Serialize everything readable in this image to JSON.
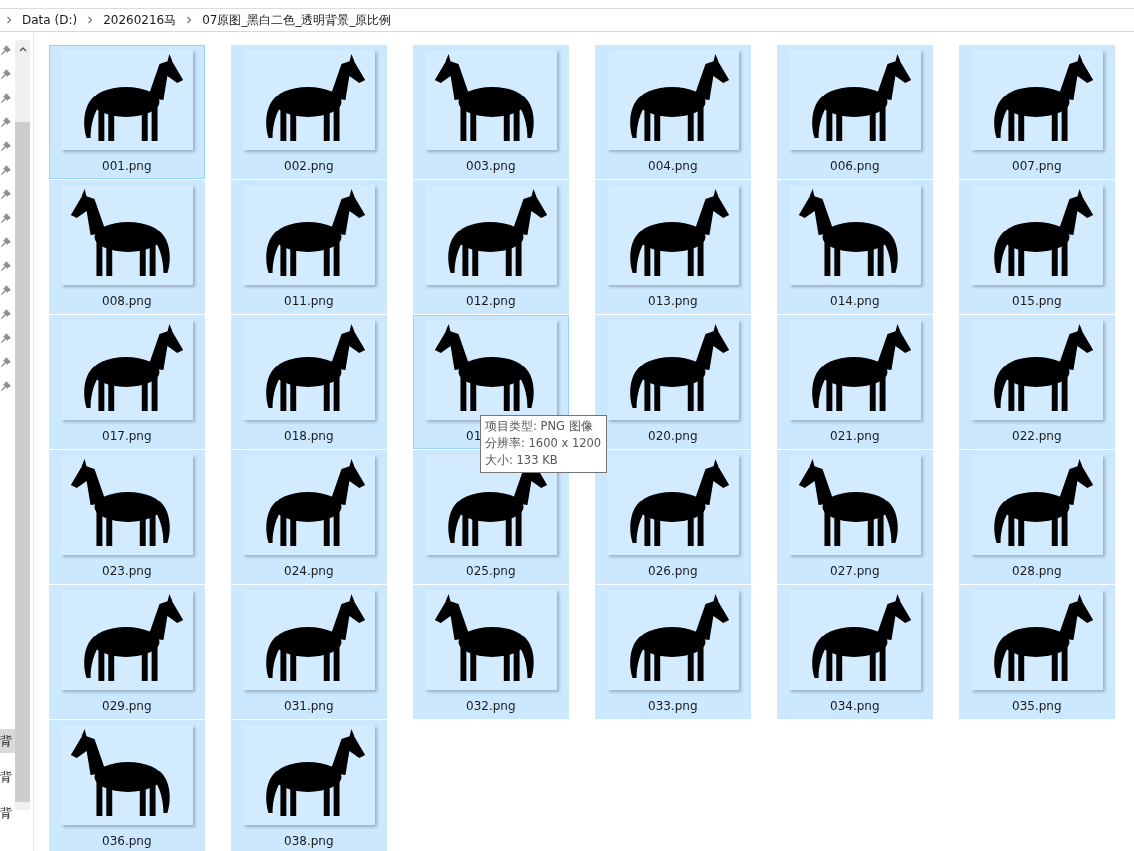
{
  "breadcrumb": [
    "Data (D:)",
    "20260216马",
    "07原图_黑白二色_透明背景_原比例"
  ],
  "nav_pane": {
    "items": [
      {
        "label": "背",
        "selected": true
      },
      {
        "label": "背",
        "selected": false
      },
      {
        "label": "背",
        "selected": false
      }
    ]
  },
  "files": [
    {
      "name": "001.png",
      "selected": true,
      "focused": true
    },
    {
      "name": "002.png",
      "selected": true,
      "focused": false
    },
    {
      "name": "003.png",
      "selected": true,
      "focused": false
    },
    {
      "name": "004.png",
      "selected": true,
      "focused": false
    },
    {
      "name": "006.png",
      "selected": true,
      "focused": false
    },
    {
      "name": "007.png",
      "selected": true,
      "focused": false
    },
    {
      "name": "008.png",
      "selected": true,
      "focused": false
    },
    {
      "name": "011.png",
      "selected": true,
      "focused": false
    },
    {
      "name": "012.png",
      "selected": true,
      "focused": false
    },
    {
      "name": "013.png",
      "selected": true,
      "focused": false
    },
    {
      "name": "014.png",
      "selected": true,
      "focused": false
    },
    {
      "name": "015.png",
      "selected": true,
      "focused": false
    },
    {
      "name": "017.png",
      "selected": true,
      "focused": false
    },
    {
      "name": "018.png",
      "selected": true,
      "focused": false
    },
    {
      "name": "01",
      "selected": true,
      "focused": true
    },
    {
      "name": "020.png",
      "selected": true,
      "focused": false
    },
    {
      "name": "021.png",
      "selected": true,
      "focused": false
    },
    {
      "name": "022.png",
      "selected": true,
      "focused": false
    },
    {
      "name": "023.png",
      "selected": true,
      "focused": false
    },
    {
      "name": "024.png",
      "selected": true,
      "focused": false
    },
    {
      "name": "025.png",
      "selected": true,
      "focused": false
    },
    {
      "name": "026.png",
      "selected": true,
      "focused": false
    },
    {
      "name": "027.png",
      "selected": true,
      "focused": false
    },
    {
      "name": "028.png",
      "selected": true,
      "focused": false
    },
    {
      "name": "029.png",
      "selected": true,
      "focused": false
    },
    {
      "name": "031.png",
      "selected": true,
      "focused": false
    },
    {
      "name": "032.png",
      "selected": true,
      "focused": false
    },
    {
      "name": "033.png",
      "selected": true,
      "focused": false
    },
    {
      "name": "034.png",
      "selected": true,
      "focused": false
    },
    {
      "name": "035.png",
      "selected": true,
      "focused": false
    },
    {
      "name": "036.png",
      "selected": true,
      "focused": false
    },
    {
      "name": "038.png",
      "selected": true,
      "focused": false
    }
  ],
  "tooltip": {
    "lines": [
      "项目类型: PNG 图像",
      "分辨率: 1600 x 1200",
      "大小: 133 KB"
    ]
  }
}
